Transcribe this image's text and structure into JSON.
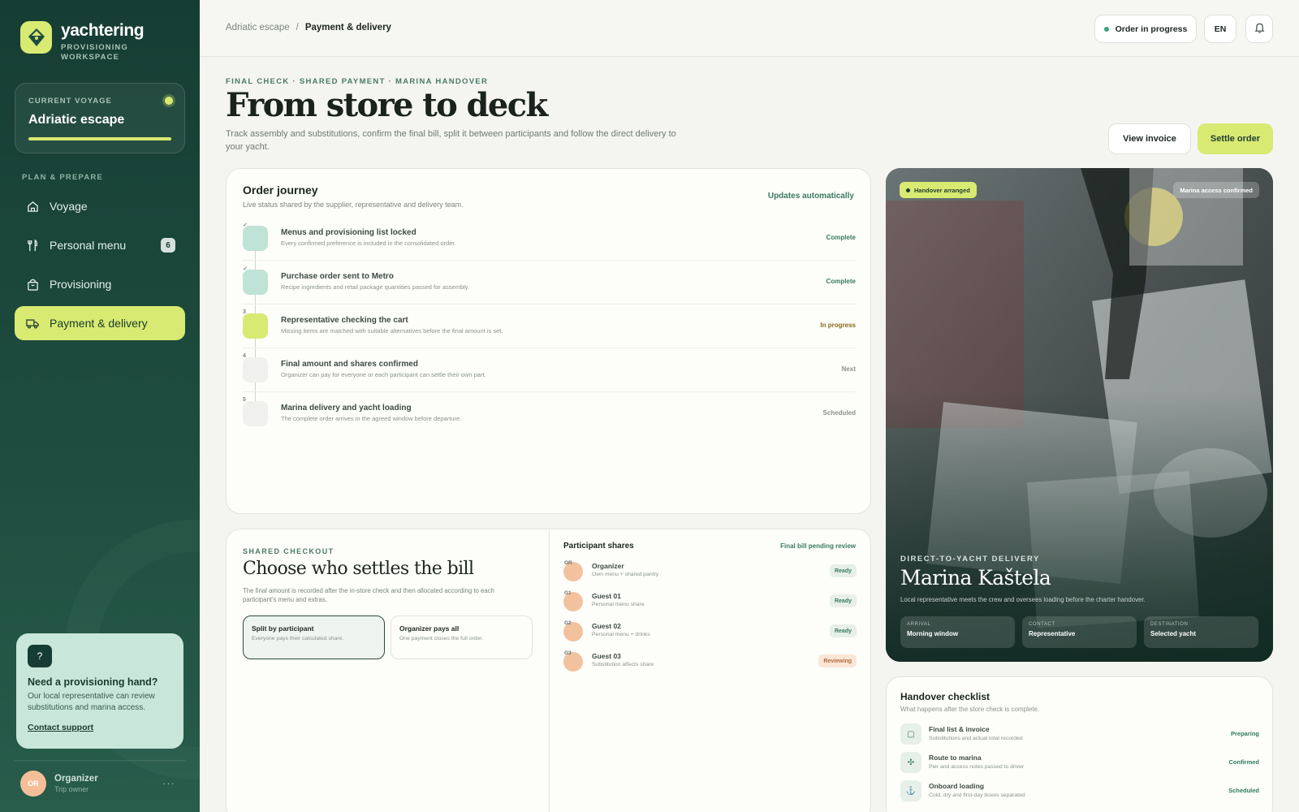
{
  "brand": {
    "name": "yachtering",
    "sub_line1": "PROVISIONING",
    "sub_line2": "WORKSPACE"
  },
  "voyage": {
    "label": "CURRENT VOYAGE",
    "name": "Adriatic escape"
  },
  "sidebar": {
    "section": "PLAN & PREPARE",
    "items": [
      {
        "label": "Voyage",
        "icon": "home-icon"
      },
      {
        "label": "Personal menu",
        "icon": "utensils-icon",
        "badge": "6"
      },
      {
        "label": "Provisioning",
        "icon": "shopping-bag-icon"
      },
      {
        "label": "Payment & delivery",
        "icon": "truck-icon",
        "active": true
      }
    ]
  },
  "help": {
    "icon": "?",
    "title": "Need a provisioning hand?",
    "text": "Our local representative can review substitutions and marina access.",
    "link": "Contact support"
  },
  "user": {
    "initials": "OR",
    "name": "Organizer",
    "role": "Trip owner",
    "more": "···"
  },
  "breadcrumb": {
    "parent": "Adriatic escape",
    "separator": "/",
    "current": "Payment & delivery"
  },
  "topbar": {
    "status": "Order in progress",
    "lang": "EN"
  },
  "header": {
    "eyebrow": "FINAL CHECK · SHARED PAYMENT · MARINA HANDOVER",
    "title": "From store to deck",
    "description": "Track assembly and substitutions, confirm the final bill, split it between participants and follow the direct delivery to your yacht.",
    "view_invoice": "View invoice",
    "settle": "Settle order"
  },
  "journey": {
    "title": "Order journey",
    "subtitle": "Live status shared by the supplier, representative and delivery team.",
    "auto": "Updates automatically",
    "steps": [
      {
        "num": "✓",
        "title": "Menus and provisioning list locked",
        "sub": "Every confirmed preference is included in the consolidated order.",
        "status": "Complete",
        "state": "done"
      },
      {
        "num": "✓",
        "title": "Purchase order sent to Metro",
        "sub": "Recipe ingredients and retail package quantities passed for assembly.",
        "status": "Complete",
        "state": "done"
      },
      {
        "num": "3",
        "title": "Representative checking the cart",
        "sub": "Missing items are matched with suitable alternatives before the final amount is set.",
        "status": "In progress",
        "state": "prog"
      },
      {
        "num": "4",
        "title": "Final amount and shares confirmed",
        "sub": "Organizer can pay for everyone or each participant can settle their own part.",
        "status": "Next",
        "state": "next"
      },
      {
        "num": "5",
        "title": "Marina delivery and yacht loading",
        "sub": "The complete order arrives in the agreed window before departure.",
        "status": "Scheduled",
        "state": "next"
      }
    ]
  },
  "checkout": {
    "eyebrow": "SHARED CHECKOUT",
    "title": "Choose who settles the bill",
    "description": "The final amount is recorded after the in-store check and then allocated according to each participant's menu and extras.",
    "options": [
      {
        "title": "Split by participant",
        "sub": "Everyone pays their calculated share."
      },
      {
        "title": "Organizer pays all",
        "sub": "One payment closes the full order."
      }
    ],
    "shares_title": "Participant shares",
    "shares_status": "Final bill pending review",
    "shares": [
      {
        "initials": "OR",
        "name": "Organizer",
        "sub": "Own menu + shared pantry",
        "status": "Ready"
      },
      {
        "initials": "G1",
        "name": "Guest 01",
        "sub": "Personal menu share",
        "status": "Ready"
      },
      {
        "initials": "G2",
        "name": "Guest 02",
        "sub": "Personal menu + drinks",
        "status": "Ready"
      },
      {
        "initials": "G3",
        "name": "Guest 03",
        "sub": "Substitution affects share",
        "status": "Reviewing"
      }
    ]
  },
  "delivery": {
    "badge": "Handover arranged",
    "access": "Marina access confirmed",
    "eyebrow": "DIRECT-TO-YACHT DELIVERY",
    "title": "Marina Kaštela",
    "description": "Local representative meets the crew and oversees loading before the charter handover.",
    "tiles": [
      {
        "label": "ARRIVAL",
        "value": "Morning window"
      },
      {
        "label": "CONTACT",
        "value": "Representative"
      },
      {
        "label": "DESTINATION",
        "value": "Selected yacht"
      }
    ]
  },
  "handover": {
    "title": "Handover checklist",
    "subtitle": "What happens after the store check is complete.",
    "items": [
      {
        "icon": "receipt-icon",
        "glyph": "▢",
        "name": "Final list & invoice",
        "desc": "Substitutions and actual total recorded",
        "status": "Preparing"
      },
      {
        "icon": "route-icon",
        "glyph": "✣",
        "name": "Route to marina",
        "desc": "Pier and access notes passed to driver",
        "status": "Confirmed"
      },
      {
        "icon": "anchor-icon",
        "glyph": "⚓",
        "name": "Onboard loading",
        "desc": "Cold, dry and first-day boxes separated",
        "status": "Scheduled"
      }
    ]
  },
  "colors": {
    "accent": "#d8ea72",
    "sidebar": "#163d33",
    "complete": "#3a7a5f",
    "in_progress": "#8a6a14",
    "reviewing_bg": "#fbe6d6"
  }
}
